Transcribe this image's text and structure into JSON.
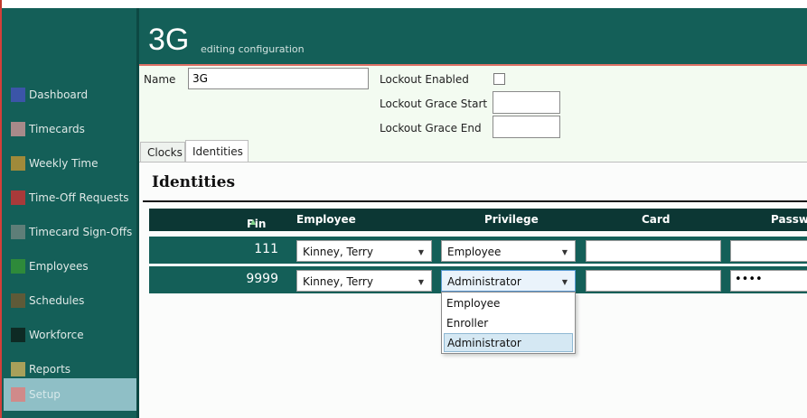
{
  "colors": {
    "sidebar_bg": "#145f58",
    "header_bg": "#145f58",
    "header_accent": "#e07367",
    "form_bg": "#f3fbf1",
    "table_header_bg": "#0c3734",
    "table_row_bg": "#145f58"
  },
  "sidebar": {
    "items": [
      {
        "label": "Dashboard",
        "color": "#3b55a8"
      },
      {
        "label": "Timecards",
        "color": "#a88a8a"
      },
      {
        "label": "Weekly Time",
        "color": "#a08a3a"
      },
      {
        "label": "Time-Off Requests",
        "color": "#a83a3a"
      },
      {
        "label": "Timecard Sign-Offs",
        "color": "#5e7e78"
      },
      {
        "label": "Employees",
        "color": "#2e8a3a"
      },
      {
        "label": "Schedules",
        "color": "#5e5a38"
      },
      {
        "label": "Workforce",
        "color": "#0e2a24"
      },
      {
        "label": "Reports",
        "color": "#a8a05a"
      },
      {
        "label": "Setup",
        "color": "#d08a8a",
        "active": true
      }
    ]
  },
  "header": {
    "title": "3G",
    "subtitle": "editing configuration"
  },
  "form": {
    "name_label": "Name",
    "name_value": "3G",
    "lockout_enabled_label": "Lockout Enabled",
    "lockout_enabled": false,
    "grace_start_label": "Lockout Grace Start",
    "grace_start_value": "",
    "grace_end_label": "Lockout Grace End",
    "grace_end_value": ""
  },
  "tabs": [
    {
      "label": "Clocks",
      "active": false
    },
    {
      "label": "Identities",
      "active": true
    }
  ],
  "identities": {
    "title": "Identities",
    "columns": [
      "Pin",
      "Employee",
      "Privilege",
      "Card",
      "Passw"
    ],
    "sort_icon": "sort-ascending-icon",
    "rows": [
      {
        "pin": "111",
        "employee": "Kinney, Terry",
        "privilege": "Employee",
        "card": "",
        "password": ""
      },
      {
        "pin": "9999",
        "employee": "Kinney, Terry",
        "privilege": "Administrator",
        "card": "",
        "password": "••••"
      }
    ]
  },
  "privilege_dropdown": {
    "options": [
      "Employee",
      "Enroller",
      "Administrator"
    ],
    "selected": "Administrator"
  }
}
